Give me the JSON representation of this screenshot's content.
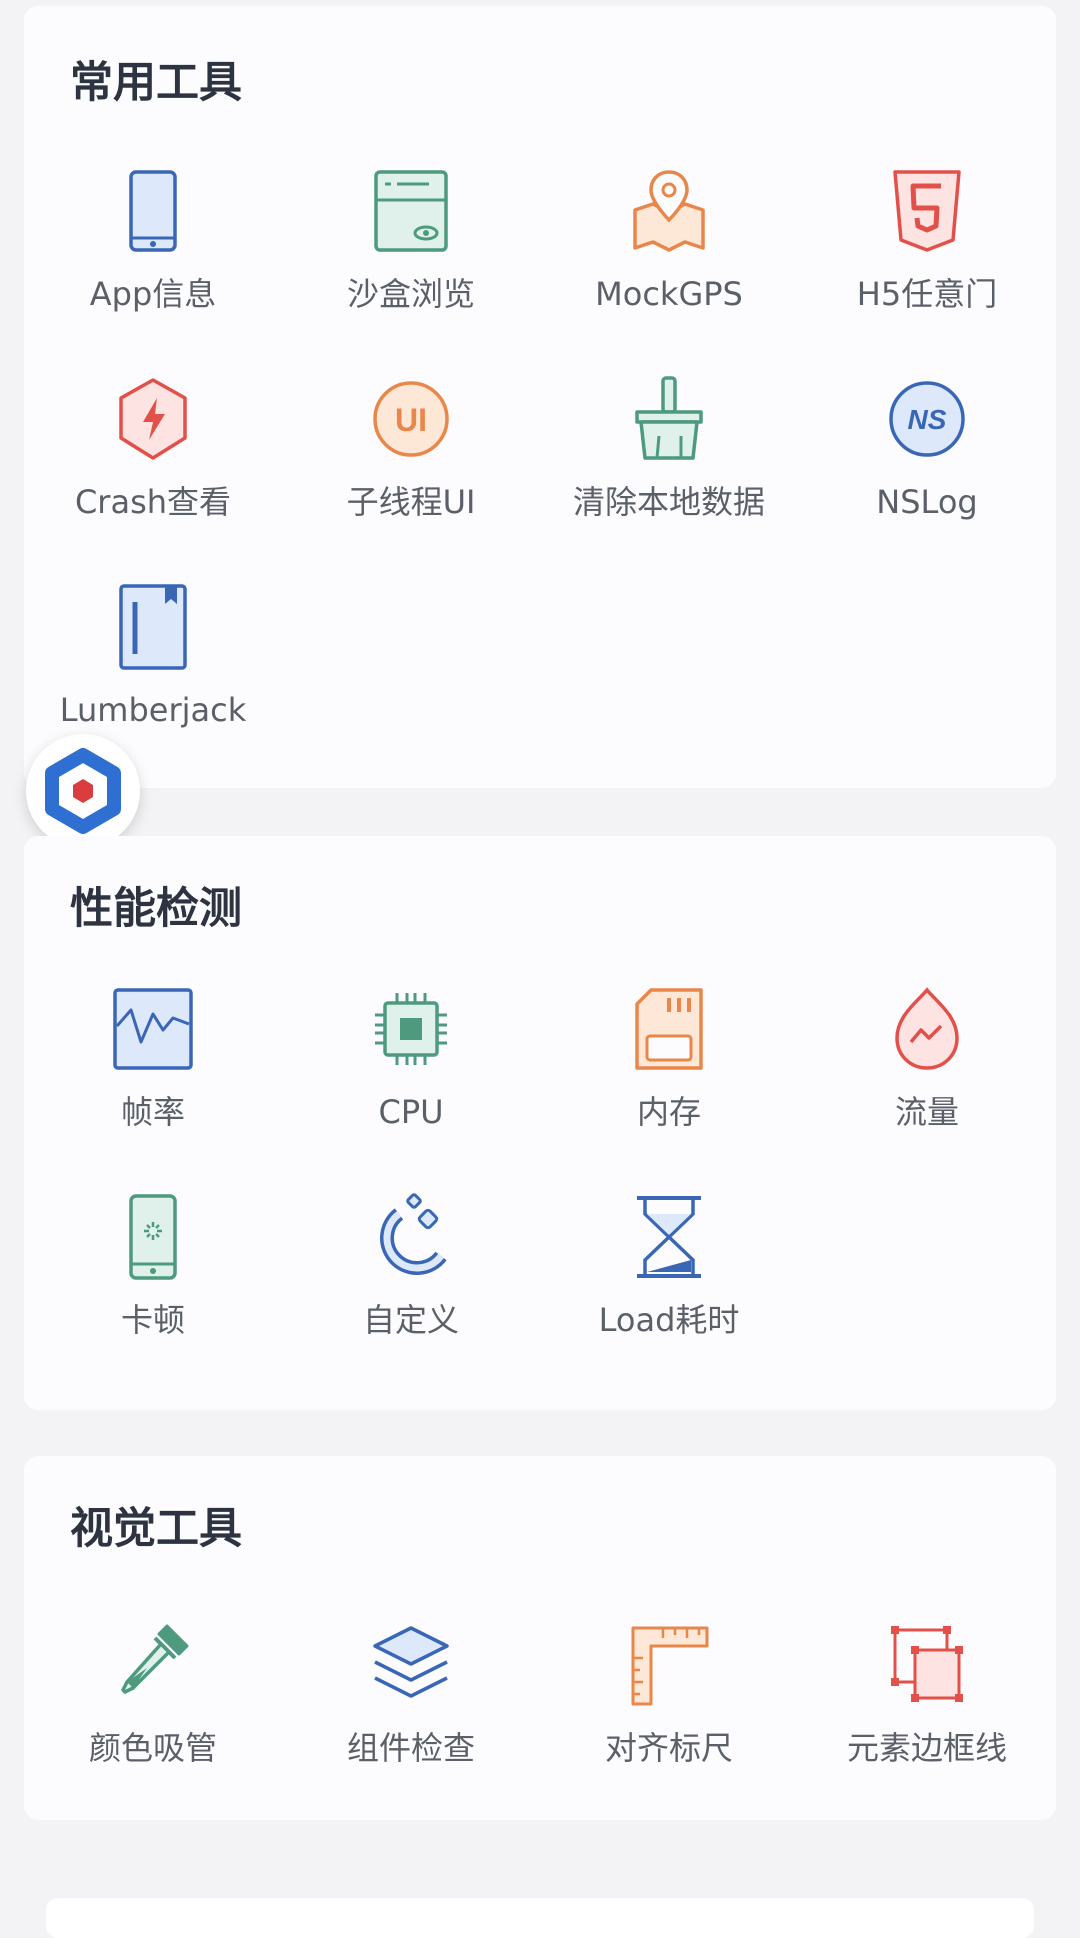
{
  "sections": [
    {
      "title": "常用工具",
      "items": [
        {
          "label": "App信息",
          "icon": "phone-info-icon"
        },
        {
          "label": "沙盒浏览",
          "icon": "sandbox-browser-icon"
        },
        {
          "label": "MockGPS",
          "icon": "map-pin-icon"
        },
        {
          "label": "H5任意门",
          "icon": "html5-icon"
        },
        {
          "label": "Crash查看",
          "icon": "crash-bolt-icon"
        },
        {
          "label": "子线程UI",
          "icon": "ui-circle-icon"
        },
        {
          "label": "清除本地数据",
          "icon": "broom-icon"
        },
        {
          "label": "NSLog",
          "icon": "nslog-icon"
        },
        {
          "label": "Lumberjack",
          "icon": "book-icon"
        }
      ]
    },
    {
      "title": "性能检测",
      "items": [
        {
          "label": "帧率",
          "icon": "frame-rate-icon"
        },
        {
          "label": "CPU",
          "icon": "cpu-chip-icon"
        },
        {
          "label": "内存",
          "icon": "memory-card-icon"
        },
        {
          "label": "流量",
          "icon": "traffic-drop-icon"
        },
        {
          "label": "卡顿",
          "icon": "phone-loading-icon"
        },
        {
          "label": "自定义",
          "icon": "custom-magnet-icon"
        },
        {
          "label": "Load耗时",
          "icon": "hourglass-icon"
        }
      ]
    },
    {
      "title": "视觉工具",
      "items": [
        {
          "label": "颜色吸管",
          "icon": "eyedropper-icon"
        },
        {
          "label": "组件检查",
          "icon": "layers-icon"
        },
        {
          "label": "对齐标尺",
          "icon": "ruler-icon"
        },
        {
          "label": "元素边框线",
          "icon": "border-frame-icon"
        }
      ]
    }
  ],
  "floating_button": {
    "icon": "doraemon-logo-icon"
  },
  "colors": {
    "blue": "#3a67b5",
    "blue_fill": "#dde8fb",
    "green": "#4d9a7e",
    "green_fill": "#dff1ea",
    "orange": "#e9874a",
    "orange_fill": "#fde7d6",
    "red": "#e2504a",
    "red_fill": "#fde3e1"
  }
}
